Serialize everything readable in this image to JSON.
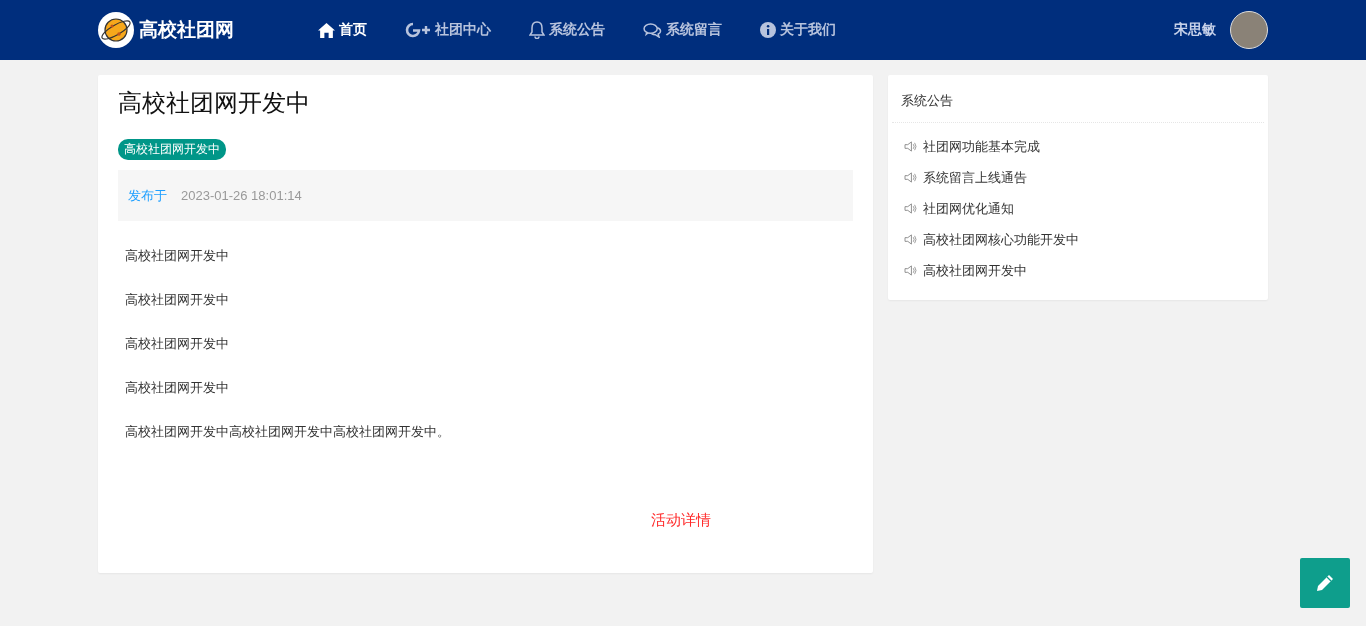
{
  "brand": {
    "name": "高校社团网"
  },
  "nav": [
    {
      "label": "首页",
      "kind": "home",
      "selected": true
    },
    {
      "label": "社团中心",
      "kind": "gplus",
      "selected": false
    },
    {
      "label": "系统公告",
      "kind": "bell",
      "selected": false
    },
    {
      "label": "系统留言",
      "kind": "chat",
      "selected": false
    },
    {
      "label": "关于我们",
      "kind": "info",
      "selected": false
    }
  ],
  "user": {
    "name": "宋思敏"
  },
  "article": {
    "title": "高校社团网开发中",
    "tag": "高校社团网开发中",
    "published_label": "发布于",
    "published_time": "2023-01-26 18:01:14",
    "paragraphs": [
      "高校社团网开发中",
      "高校社团网开发中",
      "高校社团网开发中",
      "高校社团网开发中",
      "高校社团网开发中高校社团网开发中高校社团网开发中。"
    ],
    "link": "活动详情"
  },
  "sidebar": {
    "title": "系统公告",
    "items": [
      "社团网功能基本完成",
      "系统留言上线通告",
      "社团网优化通知",
      "高校社团网核心功能开发中",
      "高校社团网开发中"
    ]
  }
}
